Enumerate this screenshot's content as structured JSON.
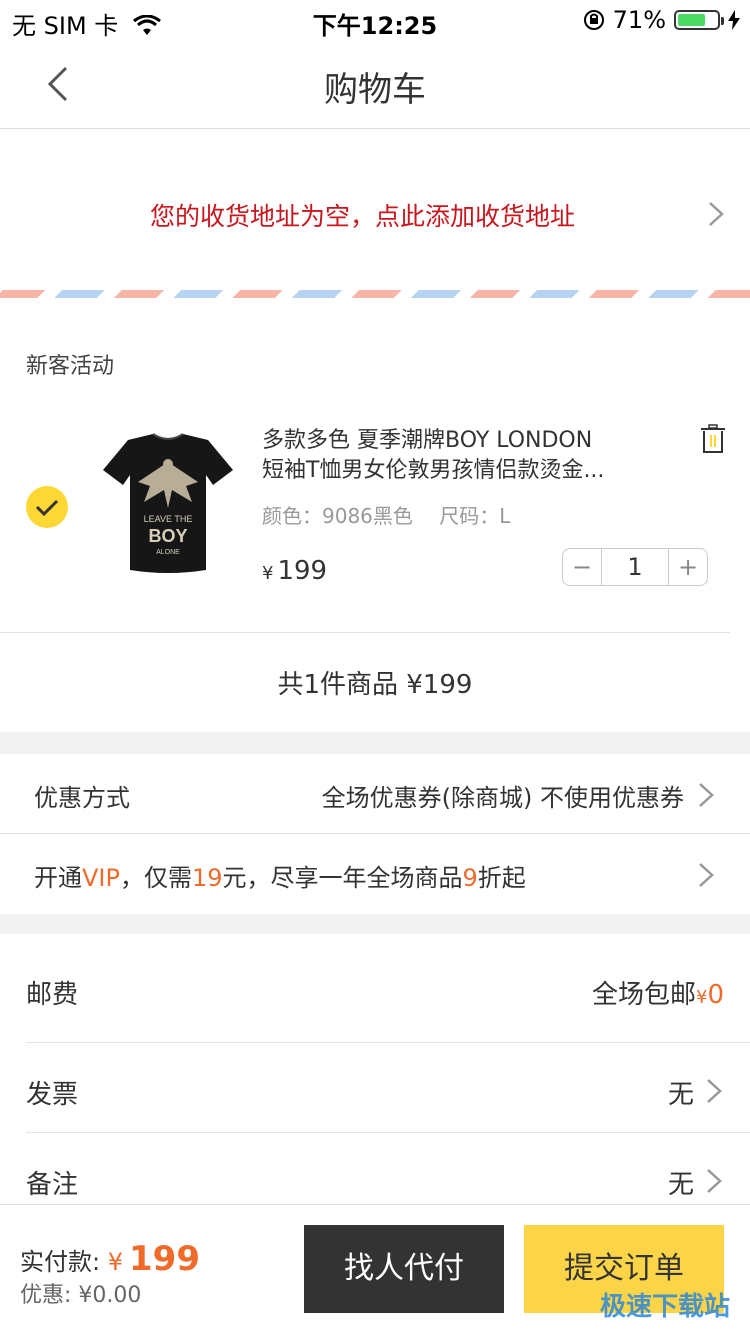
{
  "status_bar": {
    "carrier": "无 SIM 卡",
    "time": "下午12:25",
    "battery": "71%",
    "battery_level": 0.71
  },
  "nav": {
    "title": "购物车"
  },
  "address": {
    "prompt": "您的收货地址为空，点此添加收货地址"
  },
  "product_section": {
    "label": "新客活动",
    "item": {
      "title_line1": "多款多色 夏季潮牌BOY LONDON",
      "title_line2": "短袖T恤男女伦敦男孩情侣款烫金...",
      "color_label": "颜色：",
      "color_value": "9086黑色",
      "size_label": "尺码：",
      "size_value": "L",
      "price_symbol": "¥",
      "price": "199",
      "quantity": "1",
      "image_text_line1": "LEAVE THE",
      "image_text_line2": "BOY",
      "image_text_line3": "ALONE"
    },
    "summary": "共1件商品 ¥199"
  },
  "coupon": {
    "label": "优惠方式",
    "value": "全场优惠券(除商城) 不使用优惠券"
  },
  "vip": {
    "part1": "开通",
    "vip": "VIP",
    "part2": "，仅需",
    "price": "19",
    "part3": "元，尽享一年全场商品",
    "discount": "9",
    "part4": "折起"
  },
  "fees": {
    "shipping_label": "邮费",
    "shipping_value": "全场包邮",
    "shipping_symbol": "¥",
    "shipping_amount": "0",
    "invoice_label": "发票",
    "invoice_value": "无",
    "remark_label": "备注",
    "remark_value": "无"
  },
  "bottom": {
    "pay_label": "实付款:",
    "pay_symbol": "¥",
    "pay_amount": "199",
    "discount_text": "优惠: ¥0.00",
    "proxy_button": "找人代付",
    "submit_button": "提交订单"
  },
  "watermark": "极速下载站",
  "colors": {
    "accent_orange": "#f06a2a",
    "address_red": "#c8161d",
    "submit_yellow": "#fcd448",
    "check_yellow": "#fdd835"
  }
}
